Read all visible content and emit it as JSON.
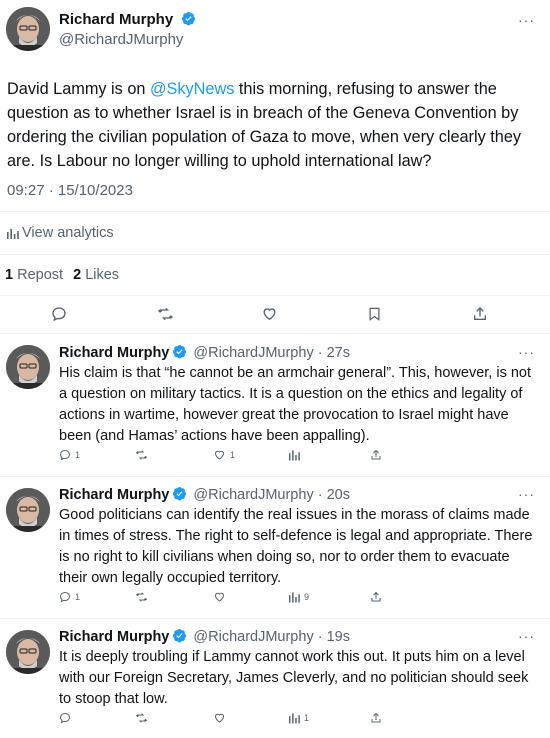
{
  "main_tweet": {
    "author_name": "Richard Murphy",
    "handle": "@RichardJMurphy",
    "text_before_mention": "David Lammy is on ",
    "mention": "@SkyNews",
    "text_after_mention": " this morning, refusing to answer the question as to whether Israel is in breach of the Geneva Convention by ordering the civilian population of Gaza to move, when very clearly they are. Is Labour no longer willing to uphold international law?",
    "timestamp": "09:27 · 15/10/2023",
    "analytics_label": "View analytics",
    "repost_count": "1",
    "repost_label": "Repost",
    "like_count": "2",
    "like_label": "Likes"
  },
  "replies": [
    {
      "author_name": "Richard Murphy",
      "handle_time": "@RichardJMurphy · 27s",
      "text": "His claim is that “he cannot be an armchair general”. This, however, is not a question on military tactics. It is a question on the ethics and legality of actions in wartime, however great the provocation to Israel might have been (and Hamas’ actions have been appalling).",
      "reply_count": "1",
      "repost_count": "",
      "like_count": "1",
      "views_count": ""
    },
    {
      "author_name": "Richard Murphy",
      "handle_time": "@RichardJMurphy · 20s",
      "text": "Good politicians can identify the real issues in the morass of claims made in times of stress. The right to self-defence is legal and appropriate. There is no right to kill civilians when doing so, nor to order them to evacuate their own legally occupied territory.",
      "reply_count": "1",
      "repost_count": "",
      "like_count": "",
      "views_count": "9"
    },
    {
      "author_name": "Richard Murphy",
      "handle_time": "@RichardJMurphy · 19s",
      "text": "It is deeply troubling if Lammy cannot work this out. It puts him on a level with our Foreign Secretary, James Cleverly, and no politician should seek to stoop that low.",
      "reply_count": "",
      "repost_count": "",
      "like_count": "",
      "views_count": "1"
    }
  ],
  "colors": {
    "accent": "#1d9bf0",
    "muted": "#536471",
    "text": "#0f1419",
    "divider": "#eff3f4"
  },
  "icons": [
    "verified-badge-icon",
    "more-icon",
    "analytics-icon",
    "reply-icon",
    "repost-icon",
    "like-icon",
    "bookmark-icon",
    "share-icon",
    "views-icon"
  ]
}
